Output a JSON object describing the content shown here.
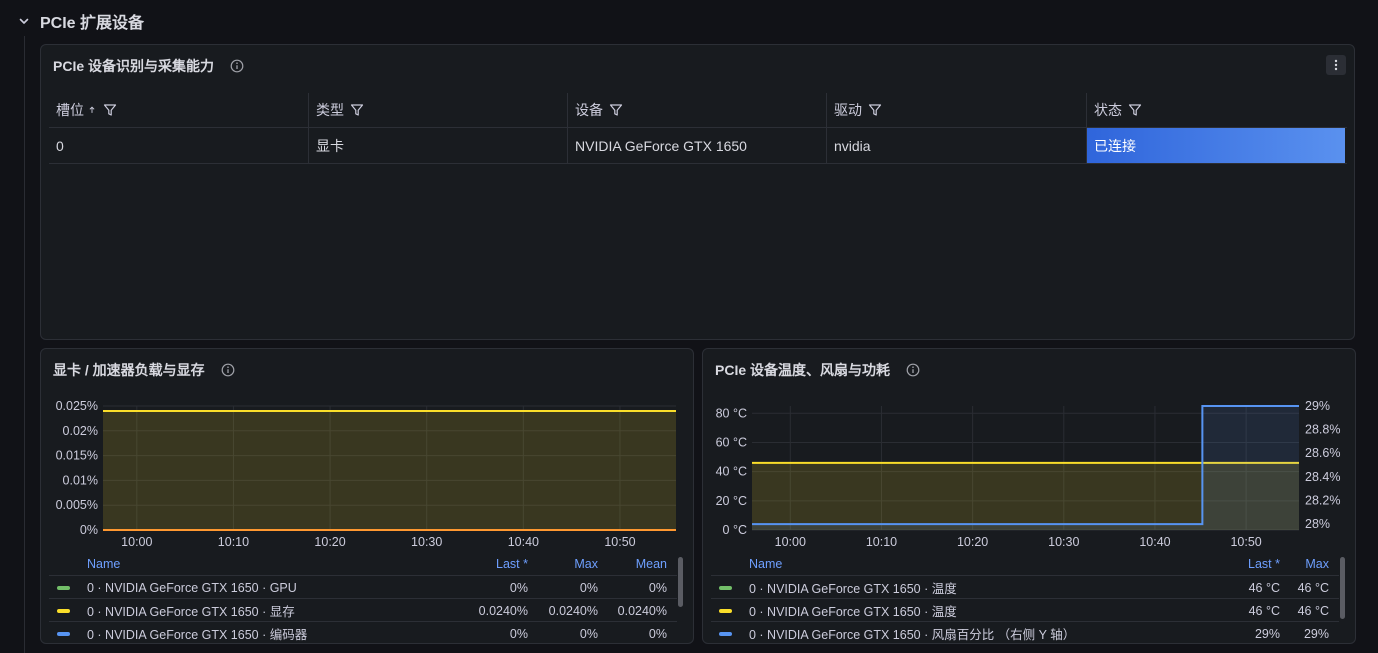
{
  "row": {
    "title": "PCIe 扩展设备"
  },
  "table_panel": {
    "title": "PCIe 设备识别与采集能力",
    "columns": [
      "槽位",
      "类型",
      "设备",
      "驱动",
      "状态"
    ],
    "rows": [
      {
        "slot": "0",
        "type": "显卡",
        "device": "NVIDIA GeForce GTX 1650",
        "driver": "nvidia",
        "status": "已连接"
      }
    ]
  },
  "gpu_panel": {
    "title": "显卡 / 加速器负载与显存",
    "legend_headers": {
      "name": "Name",
      "last": "Last *",
      "max": "Max",
      "mean": "Mean"
    },
    "legend": [
      {
        "name": "0 · NVIDIA GeForce GTX 1650 · GPU",
        "last": "0%",
        "max": "0%",
        "mean": "0%",
        "color": "#73bf69"
      },
      {
        "name": "0 · NVIDIA GeForce GTX 1650 · 显存",
        "last": "0.0240%",
        "max": "0.0240%",
        "mean": "0.0240%",
        "color": "#fade2a"
      },
      {
        "name": "0 · NVIDIA GeForce GTX 1650 · 编码器",
        "last": "0%",
        "max": "0%",
        "mean": "0%",
        "color": "#5794f2"
      }
    ]
  },
  "temp_panel": {
    "title": "PCIe 设备温度、风扇与功耗",
    "legend_headers": {
      "name": "Name",
      "last": "Last *",
      "max": "Max"
    },
    "legend": [
      {
        "name": "0 · NVIDIA GeForce GTX 1650 · 温度",
        "last": "46 °C",
        "max": "46 °C",
        "color": "#73bf69"
      },
      {
        "name": "0 · NVIDIA GeForce GTX 1650 · 温度",
        "last": "46 °C",
        "max": "46 °C",
        "color": "#fade2a"
      },
      {
        "name": "0 · NVIDIA GeForce GTX 1650 · 风扇百分比 （右侧 Y 轴）",
        "last": "29%",
        "max": "29%",
        "color": "#5794f2"
      }
    ]
  },
  "chart_data": [
    {
      "type": "area",
      "x_ticks": [
        "10:00",
        "10:10",
        "10:20",
        "10:30",
        "10:40",
        "10:50"
      ],
      "y_ticks": [
        "0.025%",
        "0.02%",
        "0.015%",
        "0.01%",
        "0.005%",
        "0%"
      ],
      "ylim": [
        0,
        0.025
      ],
      "xlim_minutes": [
        -3.5,
        55.8
      ],
      "grid": true,
      "legend_position": "bottom",
      "series": [
        {
          "name": "0 · NVIDIA GeForce GTX 1650 · GPU",
          "color": "#73bf69",
          "x": [
            -3.5,
            55.8
          ],
          "y": [
            0,
            0
          ]
        },
        {
          "name": "0 · NVIDIA GeForce GTX 1650 · 显存",
          "color": "#fade2a",
          "x": [
            -3.5,
            55.8
          ],
          "y": [
            0.024,
            0.024
          ]
        },
        {
          "name": "0 · NVIDIA GeForce GTX 1650 · 编码器",
          "color": "#ff9830",
          "x": [
            -3.5,
            55.8
          ],
          "y": [
            0,
            0
          ]
        }
      ]
    },
    {
      "type": "line",
      "x_ticks": [
        "10:00",
        "10:10",
        "10:20",
        "10:30",
        "10:40",
        "10:50"
      ],
      "y_ticks": [
        "80 °C",
        "60 °C",
        "40 °C",
        "20 °C",
        "0 °C"
      ],
      "y2_ticks": [
        "29%",
        "28.8%",
        "28.6%",
        "28.4%",
        "28.2%",
        "28%"
      ],
      "ylim": [
        0,
        85
      ],
      "y2lim": [
        27.95,
        29
      ],
      "xlim_minutes": [
        -4.2,
        55.8
      ],
      "grid": true,
      "legend_position": "bottom",
      "series": [
        {
          "name": "0 · NVIDIA GeForce GTX 1650 · 温度",
          "color": "#fade2a",
          "axis": "left",
          "x": [
            -4.2,
            55.8
          ],
          "y": [
            46,
            46
          ]
        },
        {
          "name": "0 · NVIDIA GeForce GTX 1650 · 风扇百分比 （右侧 Y 轴）",
          "color": "#5794f2",
          "axis": "right",
          "x": [
            -4.2,
            45.2,
            45.2,
            55.8
          ],
          "y": [
            28,
            28,
            29,
            29
          ]
        }
      ]
    }
  ]
}
